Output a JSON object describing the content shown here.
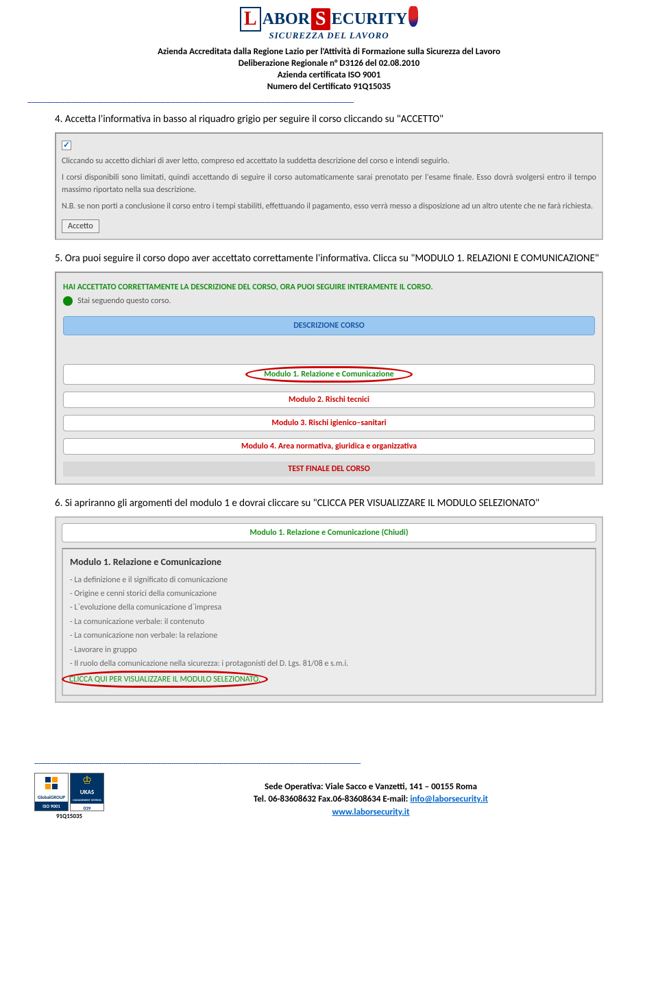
{
  "logo": {
    "l": "L",
    "abor": "ABOR",
    "s": "S",
    "ecurity": "ECURITY",
    "sub": "SICUREZZA DEL LAVORO"
  },
  "header": {
    "line1": "Azienda Accreditata dalla Regione Lazio per l'Attività di Formazione sulla Sicurezza del Lavoro",
    "line2": "Deliberazione Regionale n° D3126 del 02.08.2010",
    "line3": "Azienda certificata ISO 9001",
    "line4": "Numero del Certificato 91Q15035"
  },
  "step4": {
    "text": "4.   Accetta l'informativa in basso al riquadro grigio per seguire il corso cliccando su \"ACCETTO\""
  },
  "accept_box": {
    "p1": "Cliccando su accetto dichiari di aver letto, compreso ed accettato la suddetta descrizione del corso e intendi seguirlo.",
    "p2": "I corsi disponibili sono limitati, quindi accettando di seguire il corso automaticamente sarai prenotato per l'esame finale. Esso dovrà svolgersi entro il tempo massimo riportato nella sua descrizione.",
    "p3": "N.B. se non porti a conclusione il corso entro i tempi stabiliti, effettuando il pagamento, esso verrà messo a disposizione ad un altro utente che ne farà richiesta.",
    "btn": "Accetto"
  },
  "step5": {
    "text": "5.   Ora puoi seguire il corso dopo aver accettato correttamente l'informativa. Clicca su \"MODULO 1. RELAZIONI E COMUNICAZIONE\""
  },
  "course_box": {
    "header": "HAI ACCETTATO CORRETTAMENTE LA DESCRIZIONE DEL CORSO, ORA PUOI SEGUIRE INTERAMENTE IL CORSO.",
    "following": "Stai seguendo questo corso.",
    "desc": "DESCRIZIONE CORSO",
    "mod1": "Modulo 1. Relazione e Comunicazione",
    "mod2": "Modulo 2. Rischi tecnici",
    "mod3": "Modulo 3. Rischi igienico–sanitari",
    "mod4": "Modulo 4. Area normativa, giuridica e organizzativa",
    "test": "TEST FINALE DEL CORSO"
  },
  "step6": {
    "text": "6.   Si apriranno gli argomenti del modulo 1 e dovrai cliccare su \"CLICCA PER VISUALIZZARE IL MODULO SELEZIONATO\""
  },
  "module_detail": {
    "header": "Modulo 1. Relazione e Comunicazione (Chiudi)",
    "title": "Modulo 1. Relazione e Comunicazione",
    "items": [
      "- La definizione e il significato di comunicazione",
      "- Origine e cenni storici della comunicazione",
      "- L`evoluzione della comunicazione d`impresa",
      "- La comunicazione verbale: il contenuto",
      "- La comunicazione non verbale: la relazione",
      "- Lavorare in gruppo",
      "- Il ruolo della comunicazione nella sicurezza: i protagonisti del D. Lgs. 81/08 e s.m.i."
    ],
    "click": "CLICCA QUI PER VISUALIZZARE IL MODULO SELEZIONATO."
  },
  "footer": {
    "cert_global_top": "GlobalGROUP",
    "cert_global_bottom": "ISO 9001",
    "cert_ukas_top": "UKAS",
    "cert_ukas_mid": "MANAGEMENT SYSTEMS",
    "cert_ukas_bottom": "039",
    "cert_num": "91Q15035",
    "addr": "Sede Operativa: Viale Sacco e Vanzetti, 141 – 00155 Roma",
    "tel": "Tel. 06-83608632 Fax.06-83608634 E-mail: ",
    "email": "info@laborsecurity.it",
    "web": "www.laborsecurity.it"
  }
}
